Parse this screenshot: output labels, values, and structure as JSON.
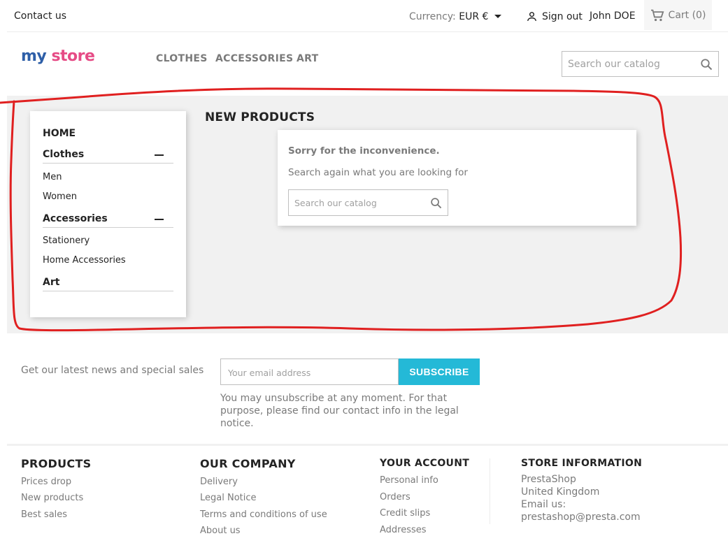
{
  "topnav": {
    "contact": "Contact us",
    "currency_label": "Currency:",
    "currency_value": "EUR €",
    "signout": "Sign out",
    "username": "John DOE",
    "cart": "Cart (0)"
  },
  "header": {
    "logo_part1": "my ",
    "logo_part2": "store",
    "menu": [
      "CLOTHES",
      "ACCESSORIES",
      "ART"
    ],
    "search_placeholder": "Search our catalog"
  },
  "sidebar": {
    "home": "HOME",
    "clothes": "Clothes",
    "clothes_children": [
      "Men",
      "Women"
    ],
    "accessories": "Accessories",
    "accessories_children": [
      "Stationery",
      "Home Accessories"
    ],
    "art": "Art"
  },
  "main": {
    "title": "NEW PRODUCTS",
    "sorry": "Sorry for the inconvenience.",
    "search_again": "Search again what you are looking for",
    "search_placeholder": "Search our catalog"
  },
  "newsletter": {
    "text": "Get our latest news and special sales",
    "email_placeholder": "Your email address",
    "subscribe": "SUBSCRIBE",
    "note": "You may unsubscribe at any moment. For that purpose, please find our contact info in the legal notice."
  },
  "footer": {
    "products": {
      "title": "PRODUCTS",
      "links": [
        "Prices drop",
        "New products",
        "Best sales"
      ]
    },
    "company": {
      "title": "OUR COMPANY",
      "links": [
        "Delivery",
        "Legal Notice",
        "Terms and conditions of use",
        "About us"
      ]
    },
    "account": {
      "title": "YOUR ACCOUNT",
      "links": [
        "Personal info",
        "Orders",
        "Credit slips",
        "Addresses"
      ]
    },
    "store": {
      "title": "STORE INFORMATION",
      "lines": [
        "PrestaShop",
        "United Kingdom",
        "Email us:",
        "prestashop@presta.com"
      ]
    }
  },
  "colors": {
    "accent": "#24b9d7",
    "annotation": "#e02020",
    "logo_blue": "#2e5fa8",
    "logo_pink": "#e64c86"
  }
}
